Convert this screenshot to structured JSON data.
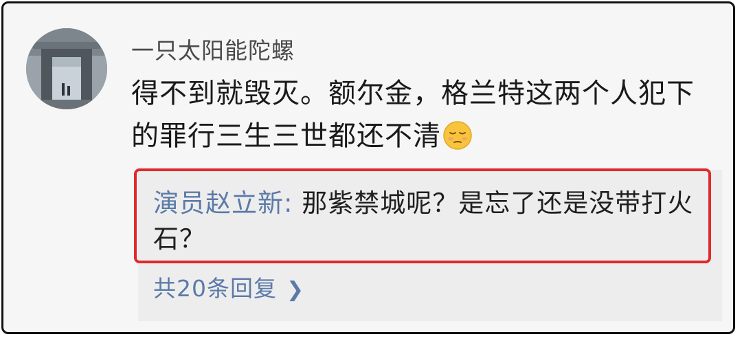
{
  "comment": {
    "username": "一只太阳能陀螺",
    "text": "得不到就毁灭。额尔金，格兰特这两个人犯下的罪行三生三世都还不清",
    "avatar_icon": "avatar-photo",
    "emoji_icon": "pensive-face-emoji"
  },
  "reply": {
    "author": "演员赵立新",
    "separator": ": ",
    "text": "那紫禁城呢？是忘了还是没带打火石？",
    "more_label": "共20条回复",
    "more_icon": "chevron-right-icon",
    "highlight_color": "#e0292f"
  }
}
